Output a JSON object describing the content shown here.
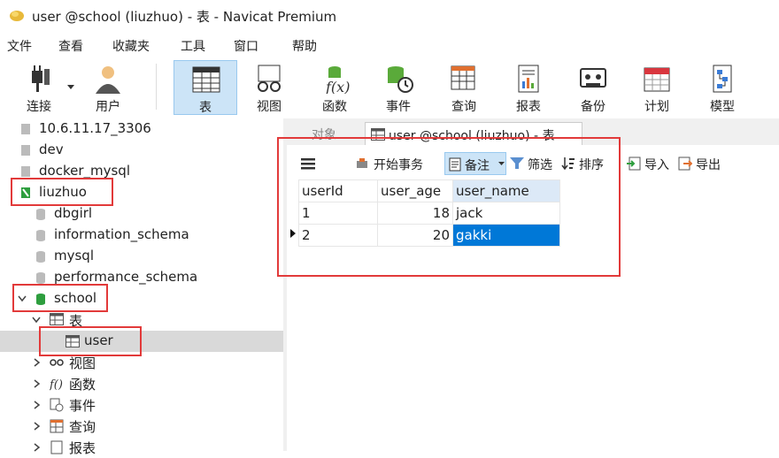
{
  "window": {
    "title": "user @school (liuzhuo) - 表 - Navicat Premium"
  },
  "menu": [
    "文件",
    "查看",
    "收藏夹",
    "工具",
    "窗口",
    "帮助"
  ],
  "toolbar": {
    "connect": "连接",
    "user": "用户",
    "table": "表",
    "view": "视图",
    "function": "函数",
    "event": "事件",
    "query": "查询",
    "report": "报表",
    "backup": "备份",
    "schedule": "计划",
    "model": "模型"
  },
  "sidebar": {
    "connections": [
      "10.6.11.17_3306",
      "dev",
      "docker_mysql",
      "liuzhuo"
    ],
    "databases": [
      "dbgirl",
      "information_schema",
      "mysql",
      "performance_schema",
      "school"
    ],
    "school_children": {
      "tables": "表",
      "user_table": "user",
      "views": "视图",
      "functions": "函数",
      "events": "事件",
      "queries": "查询",
      "reports": "报表"
    }
  },
  "tabs": {
    "objects": "对象",
    "active": "user @school (liuzhuo) - 表"
  },
  "subtoolbar": {
    "begin_txn": "开始事务",
    "note": "备注",
    "filter": "筛选",
    "sort": "排序",
    "import": "导入",
    "export": "导出"
  },
  "grid": {
    "columns": [
      "userId",
      "user_age",
      "user_name"
    ],
    "rows": [
      {
        "userId": "1",
        "user_age": "18",
        "user_name": "jack"
      },
      {
        "userId": "2",
        "user_age": "20",
        "user_name": "gakki"
      }
    ]
  },
  "colors": {
    "accent": "#0078d7",
    "highlight_box": "#e23a3a",
    "selection": "#d9d9d9"
  }
}
